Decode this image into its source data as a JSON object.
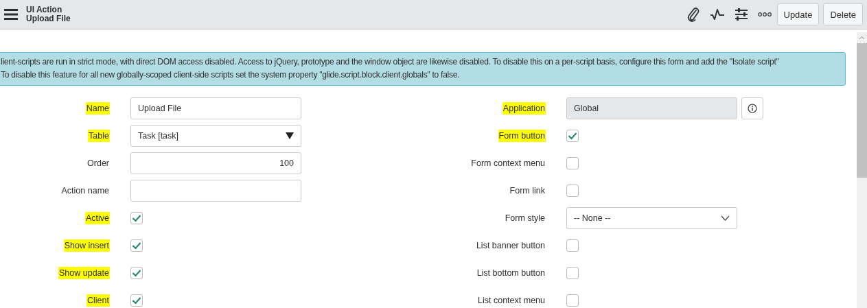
{
  "header": {
    "title": "UI Action",
    "subtitle": "Upload File",
    "buttons": [
      "Update",
      "Delete"
    ]
  },
  "banner": {
    "lines": [
      "lient-scripts are run in strict mode, with direct DOM access disabled. Access to jQuery, prototype and the window object are likewise disabled. To disable this on a per-script basis, configure this form and add the \"Isolate script\"",
      "To disable this feature for all new globally-scoped client-side scripts set the system property \"glide.script.block.client.globals\" to false."
    ]
  },
  "left_fields": [
    {
      "label": "Name",
      "highlighted": true,
      "kind": "text",
      "value": "Upload File"
    },
    {
      "label": "Table",
      "highlighted": true,
      "kind": "select",
      "value": "Task [task]"
    },
    {
      "label": "Order",
      "highlighted": false,
      "kind": "number",
      "value": "100"
    },
    {
      "label": "Action name",
      "highlighted": false,
      "kind": "text"
    },
    {
      "label": "Active",
      "highlighted": true,
      "kind": "checkbox",
      "checked": true
    },
    {
      "label": "Show insert",
      "highlighted": true,
      "kind": "checkbox",
      "checked": true
    },
    {
      "label": "Show update",
      "highlighted": true,
      "kind": "checkbox",
      "checked": true
    },
    {
      "label": "Client",
      "highlighted": true,
      "kind": "checkbox",
      "checked": true
    }
  ],
  "right_fields": [
    {
      "label": "Application",
      "highlighted": true,
      "kind": "readonly",
      "value": "Global"
    },
    {
      "label": "Form button",
      "highlighted": true,
      "kind": "checkbox",
      "checked": true
    },
    {
      "label": "Form context menu",
      "highlighted": false,
      "kind": "checkbox",
      "checked": false
    },
    {
      "label": "Form link",
      "highlighted": false,
      "kind": "checkbox",
      "checked": false
    },
    {
      "label": "Form style",
      "highlighted": false,
      "kind": "dropdown",
      "value": "-- None --"
    },
    {
      "label": "List banner button",
      "highlighted": false,
      "kind": "checkbox",
      "checked": false
    },
    {
      "label": "List bottom button",
      "highlighted": false,
      "kind": "checkbox",
      "checked": false
    },
    {
      "label": "List context menu",
      "highlighted": false,
      "kind": "checkbox",
      "checked": false
    }
  ]
}
